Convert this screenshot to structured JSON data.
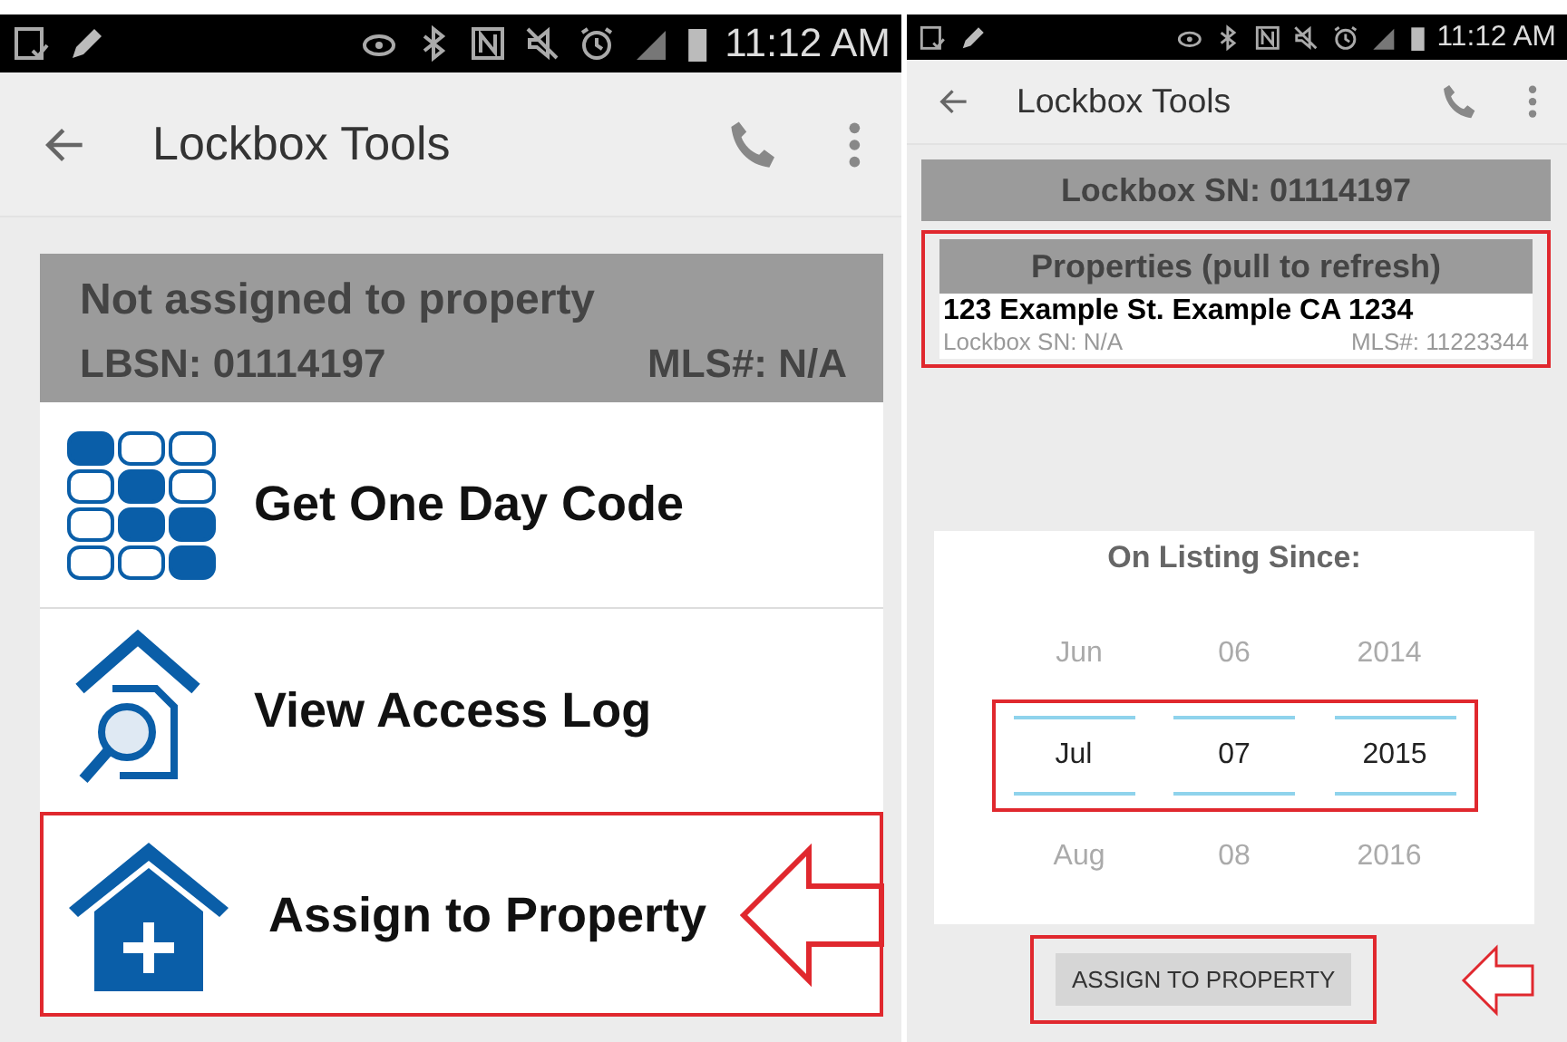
{
  "screens": [
    {
      "status_bar": {
        "time": "11:12 AM"
      },
      "toolbar": {
        "title": "Lockbox Tools"
      },
      "lockbox_card": {
        "title": "Not assigned to property",
        "lbsn": "LBSN: 01114197",
        "mls": "MLS#: N/A"
      },
      "menu": [
        {
          "kind": "keypad",
          "label": "Get One Day Code",
          "highlighted": false
        },
        {
          "kind": "log",
          "label": "View Access Log",
          "highlighted": false
        },
        {
          "kind": "assign",
          "label": "Assign to Property",
          "highlighted": true
        }
      ]
    },
    {
      "status_bar": {
        "time": "11:12 AM"
      },
      "toolbar": {
        "title": "Lockbox Tools"
      },
      "serial_header": "Lockbox SN: 01114197",
      "properties": {
        "header": "Properties (pull to refresh)",
        "highlighted": true,
        "items": [
          {
            "address": "123 Example St. Example CA 1234",
            "lockbox_sn": "Lockbox SN: N/A",
            "mls": "MLS#: 11223344"
          }
        ]
      },
      "date_picker": {
        "title": "On Listing Since:",
        "rows": [
          {
            "month": "Jun",
            "day": "06",
            "year": "2014",
            "selected": false
          },
          {
            "month": "Jul",
            "day": "07",
            "year": "2015",
            "selected": true
          },
          {
            "month": "Aug",
            "day": "08",
            "year": "2016",
            "selected": false
          }
        ]
      },
      "assign_button": {
        "label": "ASSIGN TO PROPERTY",
        "highlighted": true
      }
    }
  ]
}
